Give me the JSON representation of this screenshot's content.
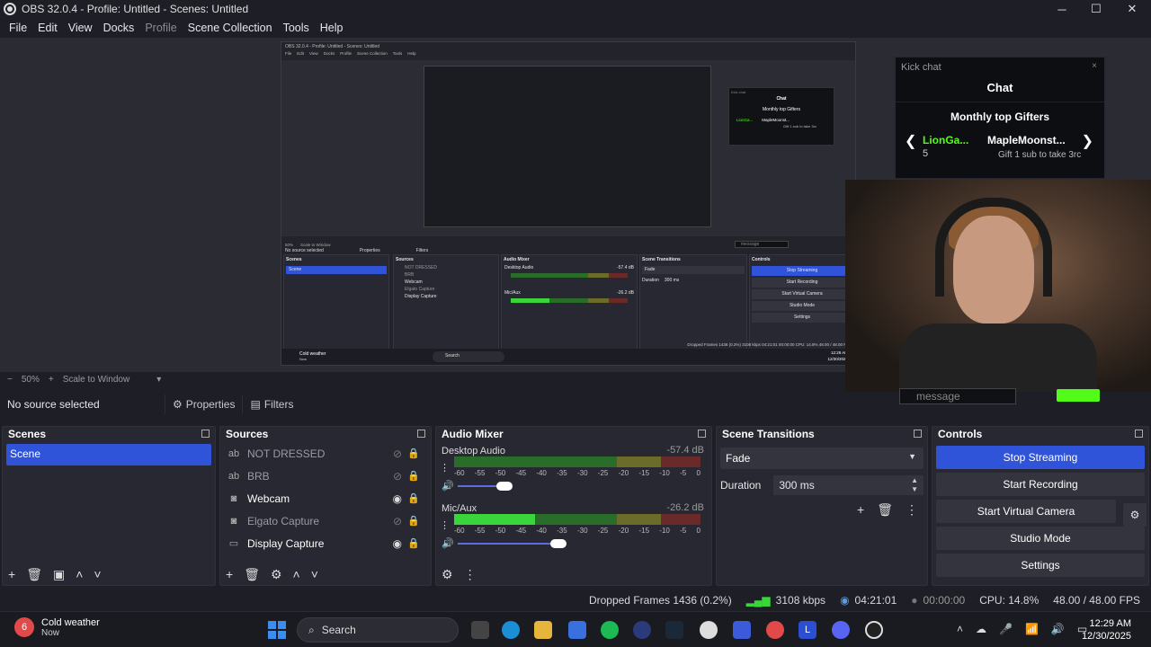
{
  "window": {
    "title": "OBS 32.0.4 - Profile: Untitled - Scenes: Untitled",
    "minimize": "─",
    "maximize": "☐",
    "close": "✕"
  },
  "menu": [
    "File",
    "Edit",
    "View",
    "Docks",
    "Profile",
    "Scene Collection",
    "Tools",
    "Help"
  ],
  "nested_obs": {
    "title": "OBS 32.0.4 - Profile: Untitled - Scenes: Untitled",
    "menu": [
      "File",
      "Edit",
      "View",
      "Docks",
      "Profile",
      "Scene Collection",
      "Tools",
      "Help"
    ],
    "no_source": "No source selected",
    "properties": "Properties",
    "filters": "Filters",
    "zoom": "50%",
    "scale": "Scale to Window",
    "docks": [
      "Scenes",
      "Sources",
      "Audio Mixer",
      "Scene Transitions",
      "Controls"
    ],
    "scene": "Scene",
    "sources": [
      "NOT DRESSED",
      "BRB",
      "Webcam",
      "Elgato Capture",
      "Display Capture"
    ],
    "mixer": [
      {
        "name": "Desktop Audio",
        "db": "-57.4 dB"
      },
      {
        "name": "Mic/Aux",
        "db": "-26.2 dB"
      }
    ],
    "transition": "Fade",
    "duration_label": "Duration",
    "duration": "300 ms",
    "controls": [
      "Stop Streaming",
      "Start Recording",
      "Start Virtual Camera",
      "Studio Mode",
      "Settings"
    ],
    "status": "Dropped Frames 1436 (0.2%)   3108 kbps   04:21:01   00:00:00   CPU: 14.8%   48.00 / 48.00 FPS",
    "weather": "Cold weather",
    "weather_sub": "Now",
    "search": "Search",
    "time": "12:29 AM",
    "date": "12/30/2025",
    "chat": {
      "header": "Kick chat",
      "title": "Chat",
      "gift_title": "Monthly top Gifters",
      "gifter1": "LionGa...",
      "gifter2": "MapleMoonst...",
      "gift_line": "Gift 1 sub to take 3rc",
      "message": "message"
    }
  },
  "kick_chat": {
    "header": "Kick chat",
    "close": "×",
    "title": "Chat",
    "gift_title": "Monthly top Gifters",
    "prev": "❮",
    "next": "❯",
    "gifter1_name": "LionGa...",
    "gifter1_count": "5",
    "gifter2_name": "MapleMoonst...",
    "gift_line": "Gift 1 sub to take 3rc",
    "message_placeholder": "message",
    "brand_green": "#53fc18"
  },
  "preview_bar": {
    "minus": "−",
    "zoom": "50%",
    "plus": "+",
    "scale": "Scale to Window",
    "arrow": "▾"
  },
  "source_bar": {
    "no_source": "No source selected",
    "properties": "Properties",
    "filters": "Filters",
    "properties_icon": "gear-icon",
    "filters_icon": "filter-icon"
  },
  "scenes": {
    "title": "Scenes",
    "items": [
      "Scene"
    ],
    "selected": "Scene"
  },
  "sources": {
    "title": "Sources",
    "items": [
      {
        "label": "NOT DRESSED",
        "icon": "text-icon",
        "glyph": "ab",
        "visible": false
      },
      {
        "label": "BRB",
        "icon": "text-icon",
        "glyph": "ab",
        "visible": false
      },
      {
        "label": "Webcam",
        "icon": "camera-icon",
        "glyph": "◙",
        "visible": true
      },
      {
        "label": "Elgato Capture",
        "icon": "camera-icon",
        "glyph": "◙",
        "visible": false
      },
      {
        "label": "Display Capture",
        "icon": "monitor-icon",
        "glyph": "▭",
        "visible": true
      }
    ]
  },
  "audio_mixer": {
    "title": "Audio Mixer",
    "ticks": [
      "-60",
      "-55",
      "-50",
      "-45",
      "-40",
      "-35",
      "-30",
      "-25",
      "-20",
      "-15",
      "-10",
      "-5",
      "0"
    ],
    "channels": [
      {
        "name": "Desktop Audio",
        "db": "-57.4 dB",
        "level": 0.0,
        "volume": 0.26
      },
      {
        "name": "Mic/Aux",
        "db": "-26.2 dB",
        "level": 0.33,
        "volume": 0.56
      }
    ]
  },
  "transitions": {
    "title": "Scene Transitions",
    "selected": "Fade",
    "duration_label": "Duration",
    "duration": "300 ms"
  },
  "controls": {
    "title": "Controls",
    "buttons": [
      "Stop Streaming",
      "Start Recording",
      "Start Virtual Camera",
      "Studio Mode",
      "Settings"
    ],
    "accent": "#2f54d9"
  },
  "status": {
    "dropped": "Dropped Frames 1436 (0.2%)",
    "kbps": "3108 kbps",
    "stream_time": "04:21:01",
    "rec_time": "00:00:00",
    "cpu": "CPU: 14.8%",
    "fps": "48.00 / 48.00 FPS"
  },
  "taskbar": {
    "weather_title": "Cold weather",
    "weather_sub": "Now",
    "weather_badge": "6",
    "search": "Search",
    "time": "12:29 AM",
    "date": "12/30/2025",
    "apps": [
      "file-explorer-icon",
      "edge-icon",
      "folder-icon",
      "store-icon",
      "spotify-icon",
      "video-icon",
      "steam-icon",
      "app-icon",
      "app-icon",
      "chrome-icon",
      "lunar-icon",
      "discord-icon",
      "obs-icon"
    ]
  }
}
